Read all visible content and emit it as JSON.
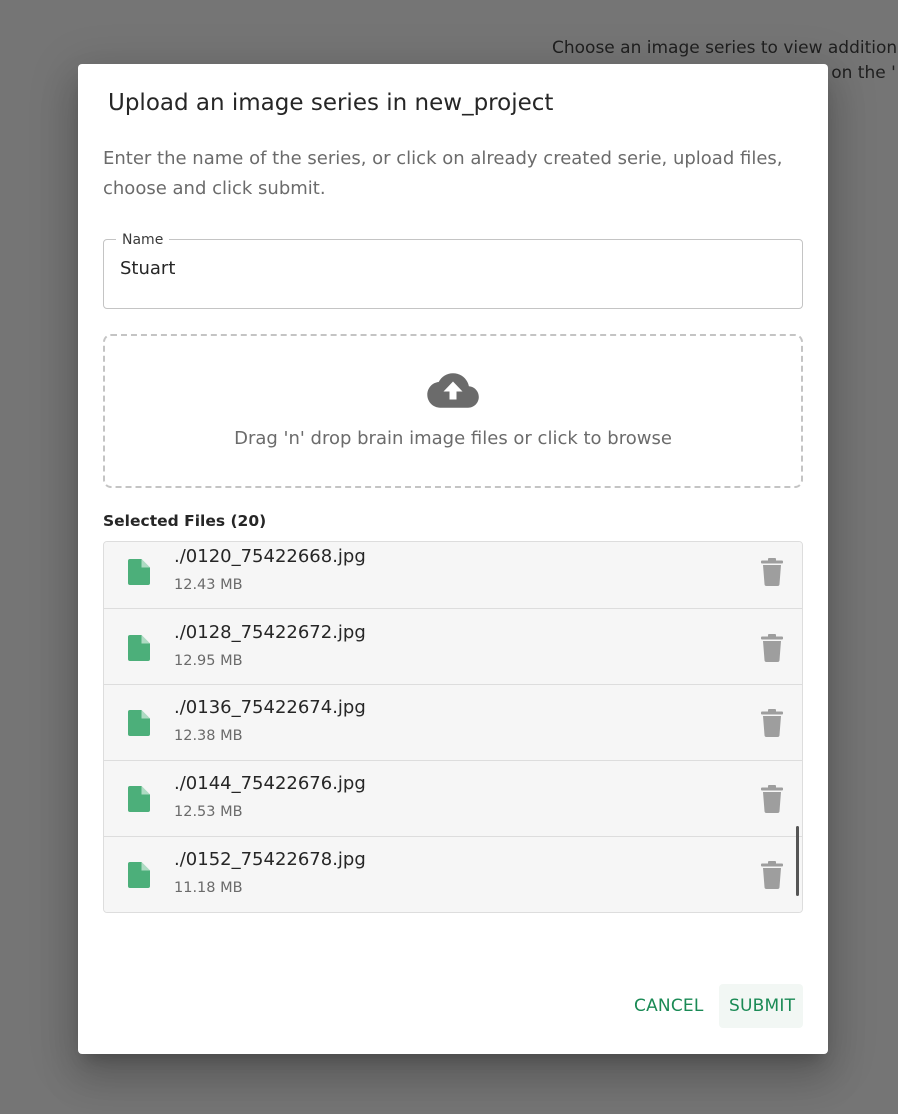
{
  "background": {
    "line1": "Choose an image series to view additional",
    "line2": "g on the '"
  },
  "dialog": {
    "title": "Upload an image series in new_project",
    "description": "Enter the name of the series, or click on already created serie, upload files, choose and click submit.",
    "name_field": {
      "label": "Name",
      "value": "Stuart"
    },
    "dropzone": {
      "icon": "cloud-upload-icon",
      "text": "Drag 'n' drop brain image files or click to browse"
    },
    "selected_files": {
      "heading": "Selected Files (20)",
      "items": [
        {
          "name": "./0120_75422668.jpg",
          "size": "12.43 MB"
        },
        {
          "name": "./0128_75422672.jpg",
          "size": "12.95 MB"
        },
        {
          "name": "./0136_75422674.jpg",
          "size": "12.38 MB"
        },
        {
          "name": "./0144_75422676.jpg",
          "size": "12.53 MB"
        },
        {
          "name": "./0152_75422678.jpg",
          "size": "11.18 MB"
        }
      ]
    },
    "actions": {
      "cancel_label": "CANCEL",
      "submit_label": "SUBMIT"
    }
  },
  "colors": {
    "accent": "#1a8a55",
    "file_icon": "#4caf7a",
    "delete_icon": "#9e9e9e",
    "overlay": "#757575"
  }
}
